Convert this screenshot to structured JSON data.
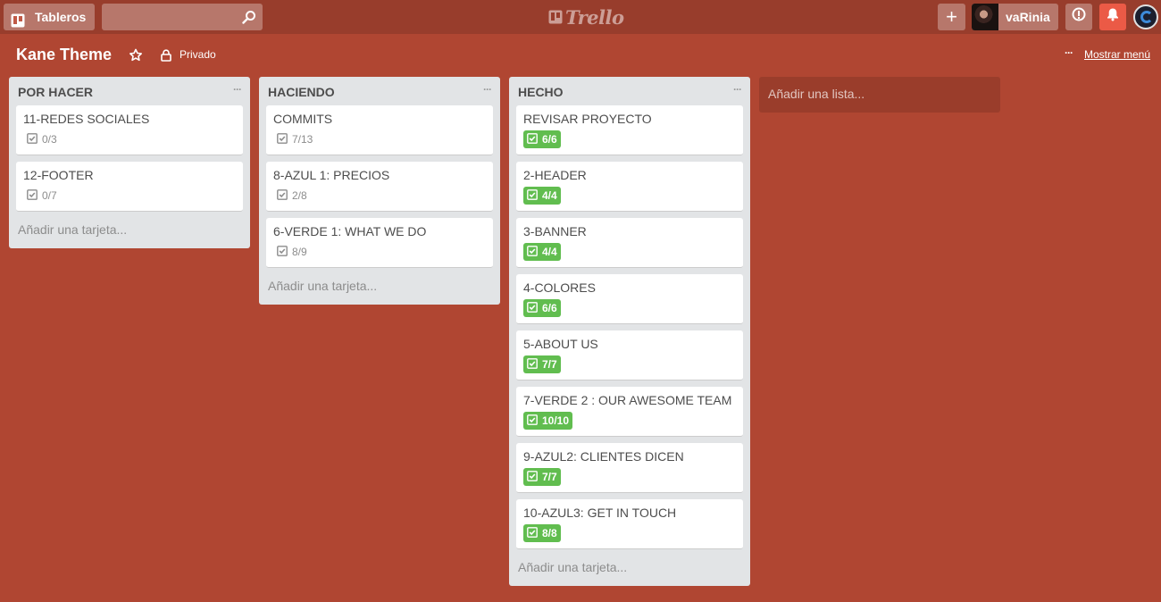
{
  "header": {
    "boards_label": "Tableros",
    "search_placeholder": "",
    "logo_text": "Trello",
    "add_label": "+",
    "username": "vaRinia"
  },
  "board": {
    "title": "Kane Theme",
    "privacy_label": "Privado",
    "show_menu_label": "Mostrar menú",
    "menu_dots": "···"
  },
  "colors": {
    "background": "#b04632",
    "header": "#983d2c",
    "complete_badge": "#61bd4f",
    "notification": "#eb5a46"
  },
  "lists": [
    {
      "title": "POR HACER",
      "cards": [
        {
          "title": "11-REDES SOCIALES",
          "checklist": "0/3",
          "complete": false
        },
        {
          "title": "12-FOOTER",
          "checklist": "0/7",
          "complete": false
        }
      ],
      "add_card_label": "Añadir una tarjeta..."
    },
    {
      "title": "HACIENDO",
      "cards": [
        {
          "title": "COMMITS",
          "checklist": "7/13",
          "complete": false
        },
        {
          "title": "8-AZUL 1: PRECIOS",
          "checklist": "2/8",
          "complete": false
        },
        {
          "title": "6-VERDE 1: WHAT WE DO",
          "checklist": "8/9",
          "complete": false
        }
      ],
      "add_card_label": "Añadir una tarjeta..."
    },
    {
      "title": "HECHO",
      "cards": [
        {
          "title": "REVISAR PROYECTO",
          "checklist": "6/6",
          "complete": true
        },
        {
          "title": "2-HEADER",
          "checklist": "4/4",
          "complete": true
        },
        {
          "title": "3-BANNER",
          "checklist": "4/4",
          "complete": true
        },
        {
          "title": "4-COLORES",
          "checklist": "6/6",
          "complete": true
        },
        {
          "title": "5-ABOUT US",
          "checklist": "7/7",
          "complete": true
        },
        {
          "title": "7-VERDE 2 : OUR AWESOME TEAM",
          "checklist": "10/10",
          "complete": true
        },
        {
          "title": "9-AZUL2: CLIENTES DICEN",
          "checklist": "7/7",
          "complete": true
        },
        {
          "title": "10-AZUL3: GET IN TOUCH",
          "checklist": "8/8",
          "complete": true
        }
      ],
      "add_card_label": "Añadir una tarjeta..."
    }
  ],
  "add_list_label": "Añadir una lista..."
}
